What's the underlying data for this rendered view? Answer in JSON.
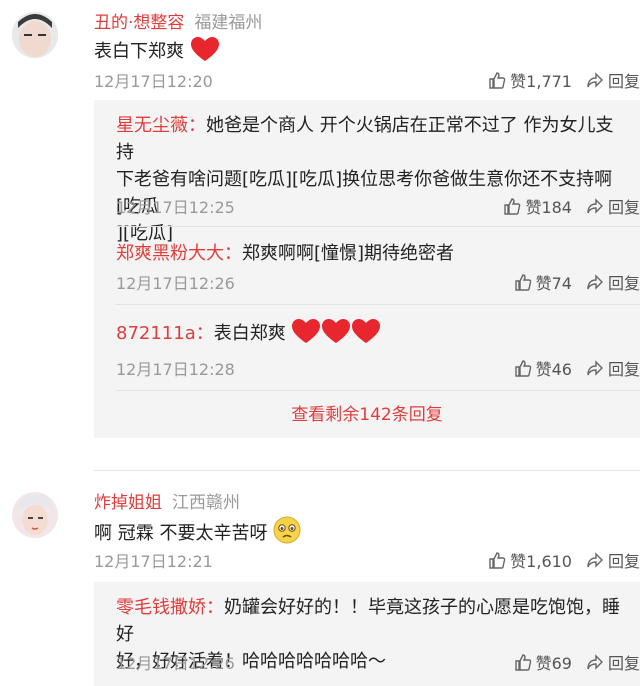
{
  "comments": [
    {
      "user": "丑的·想整容",
      "location": "福建福州",
      "text": "表白下郑爽",
      "time": "12月17日12:20",
      "likes": "赞1,771",
      "reply": "回复",
      "replies": [
        {
          "user": "星无尘薇：",
          "text_lines": [
            "她爸是个商人  开个火锅店在正常不过了   作为女儿支持",
            "下老爸有啥问题[吃瓜][吃瓜]换位思考你爸做生意你还不支持啊[吃瓜",
            "][吃瓜]"
          ],
          "time": "12月17日12:25",
          "likes": "赞184",
          "reply": "回复"
        },
        {
          "user": "郑爽黑粉大大：",
          "text": "郑爽啊啊[憧憬]期待绝密者",
          "time": "12月17日12:26",
          "likes": "赞74",
          "reply": "回复"
        },
        {
          "user": "872111a：",
          "text": "表白郑爽",
          "time": "12月17日12:28",
          "likes": "赞46",
          "reply": "回复"
        }
      ],
      "more": "查看剩余142条回复"
    },
    {
      "user": "炸掉姐姐",
      "location": "江西赣州",
      "text": "啊  冠霖  不要太辛苦呀",
      "time": "12月17日12:21",
      "likes": "赞1,610",
      "reply": "回复",
      "replies": [
        {
          "user": "零毛钱撒娇：",
          "text_lines": [
            "奶罐会好好的！！毕竟这孩子的心愿是吃饱饱，睡好",
            "好，好好活着！哈哈哈哈哈哈哈～"
          ],
          "time": "12月17日12:26",
          "likes": "赞69",
          "reply": "回复"
        }
      ]
    }
  ],
  "colors": {
    "accent": "#e03d3d",
    "muted": "#999999",
    "reply_bg": "#f4f4f4",
    "heart": "#e8262e"
  }
}
